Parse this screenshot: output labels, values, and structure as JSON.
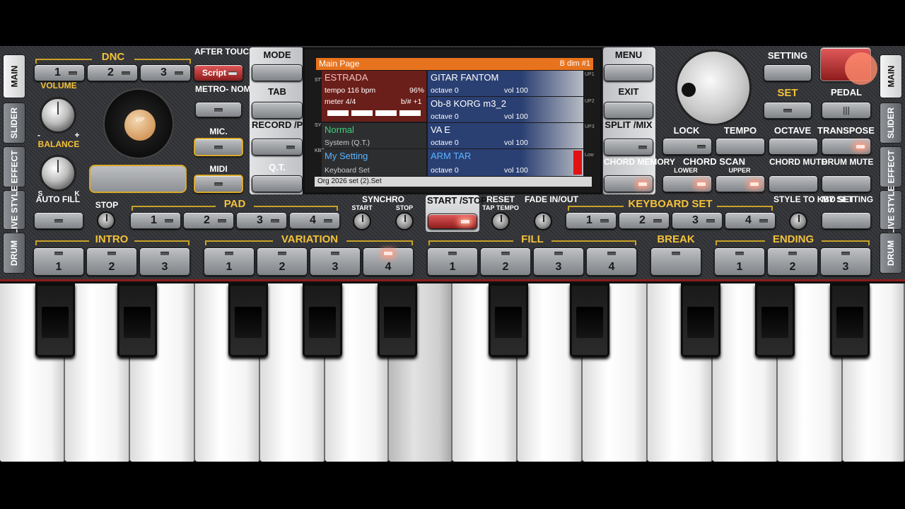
{
  "left_tabs": [
    "MAIN",
    "SLIDER",
    "EFFECT",
    "LIVE STYLE",
    "DRUM"
  ],
  "right_tabs": [
    "MAIN",
    "SLIDER",
    "EFFECT",
    "LIVE STYLE",
    "DRUM"
  ],
  "labels": {
    "dnc": "DNC",
    "after_touch": "AFTER TOUCH",
    "volume": "VOLUME",
    "balance": "BALANCE",
    "metronome": "METRO- NOME",
    "mic": "MIC.",
    "midi": "MIDI",
    "auto_fill": "AUTO FILL",
    "minus": "-",
    "plus": "+",
    "s": "S",
    "k": "K",
    "vip": "VIP",
    "stop": "STOP",
    "pad": "PAD",
    "synchro": "SYNCHRO",
    "synchro_start": "START",
    "synchro_stop": "STOP",
    "reset": "RESET",
    "tap_tempo": "TAP TEMPO",
    "fade": "FADE IN/OUT",
    "keyboard_set": "KEYBOARD SET",
    "style_to_kbd": "STYLE TO KBD SET",
    "my_setting": "MY SETTING",
    "intro": "INTRO",
    "variation": "VARIATION",
    "fill": "FILL",
    "break": "BREAK",
    "ending": "ENDING",
    "setting": "SETTING",
    "set": "SET",
    "pedal": "PEDAL",
    "lock": "LOCK",
    "tempo": "TEMPO",
    "octave": "OCTAVE",
    "transpose": "TRANSPOSE",
    "chord_scan": "CHORD SCAN",
    "lower": "LOWER",
    "upper": "UPPER",
    "chord_mute": "CHORD MUTE",
    "drum_mute": "DRUM MUTE",
    "chord_memory": "CHORD MEMORY"
  },
  "buttons": {
    "dnc": [
      "1",
      "2",
      "3"
    ],
    "script": "Script",
    "mode": "MODE",
    "tab": "TAB",
    "record_play": "RECORD /PLAY",
    "qt": "Q.T.",
    "menu": "MENU",
    "exit": "EXIT",
    "split_mix": "SPLIT /MIX",
    "start_stop": "START /STOP",
    "pad": [
      "1",
      "2",
      "3",
      "4"
    ],
    "keyboard_set": [
      "1",
      "2",
      "3",
      "4"
    ],
    "intro": [
      "1",
      "2",
      "3"
    ],
    "variation": [
      "1",
      "2",
      "3",
      "4"
    ],
    "fill": [
      "1",
      "2",
      "3",
      "4"
    ],
    "ending": [
      "1",
      "2",
      "3"
    ]
  },
  "screen": {
    "title": "Main Page",
    "chord": "B dim #1",
    "style": {
      "name": "ESTRADA",
      "tempo": "tempo 116 bpm",
      "percent": "96%",
      "meter": "meter 4/4",
      "key": "b/# +1"
    },
    "sys": {
      "name": "Normal",
      "sub": "System (Q.T.)"
    },
    "kbd": {
      "name": "My Setting",
      "sub": "Keyboard Set"
    },
    "up1": {
      "name": "GITAR FANTOM",
      "octave": "octave 0",
      "vol": "vol 100"
    },
    "up2": {
      "name": "Ob-8 KORG m3_2",
      "octave": "octave 0",
      "vol": "vol 100"
    },
    "up3": {
      "name": "VA E",
      "octave": "octave 0",
      "vol": "vol 100"
    },
    "low": {
      "name": "ARM TAR",
      "octave": "octave 0",
      "vol": "vol 100"
    },
    "footer": "Org 2026 set (2).Set",
    "side_style": "STYLE",
    "side_sys": "SYS",
    "side_kbd": "KBD",
    "side_up1": "UP1",
    "side_up2": "UP2",
    "side_up3": "UP3",
    "side_low": "Low"
  },
  "colors": {
    "accent": "#f3c23a",
    "header": "#e8731e",
    "led_on": "#ff9b83"
  }
}
